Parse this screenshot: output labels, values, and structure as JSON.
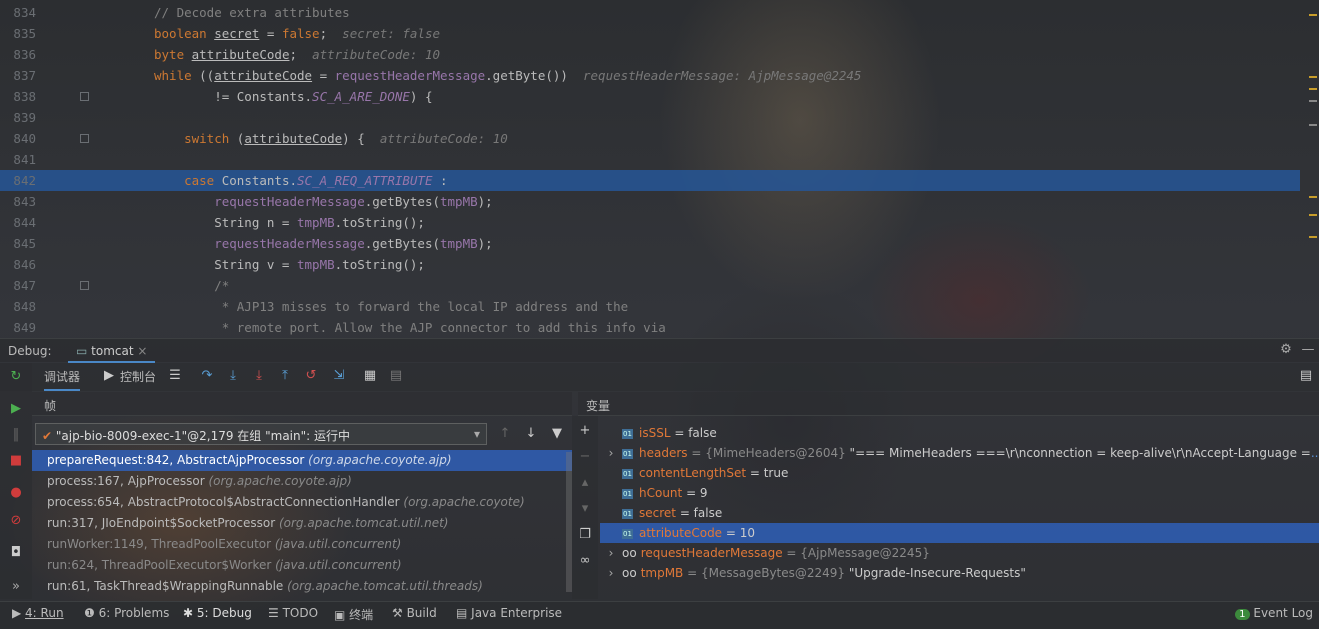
{
  "editor": {
    "lines": [
      {
        "n": "834",
        "html": "<span class='cm'>// Decode extra attributes</span>"
      },
      {
        "n": "835",
        "html": "<span class='kw'>boolean </span><span class='u'>secret</span> = <span class='kw'>false</span>;  <span class='hint'>secret: false</span>"
      },
      {
        "n": "836",
        "html": "<span class='kw'>byte </span><span class='u'>attributeCode</span>;  <span class='hint'>attributeCode: 10</span>"
      },
      {
        "n": "837",
        "html": "<span class='kw'>while </span>((<span class='u'>attributeCode</span> = <span class='fld'>requestHeaderMessage</span>.getByte())  <span class='hint'>requestHeaderMessage: AjpMessage@2245</span>"
      },
      {
        "n": "838",
        "html": "        != Constants.<span class='cst'>SC_A_ARE_DONE</span>) {"
      },
      {
        "n": "839",
        "html": ""
      },
      {
        "n": "840",
        "html": "    <span class='kw'>switch </span>(<span class='u'>attributeCode</span>) {  <span class='hint'>attributeCode: 10</span>"
      },
      {
        "n": "841",
        "html": ""
      },
      {
        "n": "842",
        "html": "    <span class='kw'>case </span>Constants.<span class='cst'>SC_A_REQ_ATTRIBUTE</span> :"
      },
      {
        "n": "843",
        "html": "        <span class='fld'>requestHeaderMessage</span>.getBytes(<span class='fld'>tmpMB</span>);"
      },
      {
        "n": "844",
        "html": "        String n = <span class='fld'>tmpMB</span>.toString();"
      },
      {
        "n": "845",
        "html": "        <span class='fld'>requestHeaderMessage</span>.getBytes(<span class='fld'>tmpMB</span>);"
      },
      {
        "n": "846",
        "html": "        String v = <span class='fld'>tmpMB</span>.toString();"
      },
      {
        "n": "847",
        "html": "        <span class='cm'>/*</span>"
      },
      {
        "n": "848",
        "html": "<span class='cm'>         * AJP13 misses to forward the local IP address and the</span>"
      },
      {
        "n": "849",
        "html": "<span class='cm'>         * remote port. Allow the AJP connector to add this info via</span>"
      }
    ],
    "current_line": "842"
  },
  "debug": {
    "label": "Debug:",
    "tab": "tomcat",
    "subtab_debugger": "调试器",
    "subtab_console": "控制台",
    "frames_title": "帧",
    "vars_title": "变量",
    "thread": "\"ajp-bio-8009-exec-1\"@2,179 在组 \"main\": 运行中",
    "frames": [
      {
        "m": "prepareRequest:842, AbstractAjpProcessor",
        "p": "(org.apache.coyote.ajp)"
      },
      {
        "m": "process:167, AjpProcessor",
        "p": "(org.apache.coyote.ajp)"
      },
      {
        "m": "process:654, AbstractProtocol$AbstractConnectionHandler",
        "p": "(org.apache.coyote)"
      },
      {
        "m": "run:317, JIoEndpoint$SocketProcessor",
        "p": "(org.apache.tomcat.util.net)"
      },
      {
        "m": "runWorker:1149, ThreadPoolExecutor",
        "p": "(java.util.concurrent)"
      },
      {
        "m": "run:624, ThreadPoolExecutor$Worker",
        "p": "(java.util.concurrent)"
      },
      {
        "m": "run:61, TaskThread$WrappingRunnable",
        "p": "(org.apache.tomcat.util.threads)"
      }
    ],
    "vars": [
      {
        "name": "isSSL",
        "val": " = false",
        "type": "",
        "exp": false
      },
      {
        "name": "headers",
        "val": " \"=== MimeHeaders ===\\r\\nconnection = keep-alive\\r\\nAccept-Language =",
        "type": " = {MimeHeaders@2604}",
        "exp": true,
        "more": "...(显示"
      },
      {
        "name": "contentLengthSet",
        "val": " = true",
        "type": "",
        "exp": false
      },
      {
        "name": "hCount",
        "val": " = 9",
        "type": "",
        "exp": false
      },
      {
        "name": "secret",
        "val": " = false",
        "type": "",
        "exp": false
      },
      {
        "name": "attributeCode",
        "val": " = 10",
        "type": "",
        "exp": false
      },
      {
        "name": "requestHeaderMessage",
        "val": "",
        "type": " = {AjpMessage@2245}",
        "exp": true
      },
      {
        "name": "tmpMB",
        "val": " \"Upgrade-Insecure-Requests\"",
        "type": " = {MessageBytes@2249}",
        "exp": true
      }
    ]
  },
  "status": {
    "run": "4: Run",
    "problems": "6: Problems",
    "debug": "5: Debug",
    "todo": "TODO",
    "terminal": "终端",
    "build": "Build",
    "java_ent": "Java Enterprise",
    "event_log": "Event Log",
    "event_count": "1"
  }
}
